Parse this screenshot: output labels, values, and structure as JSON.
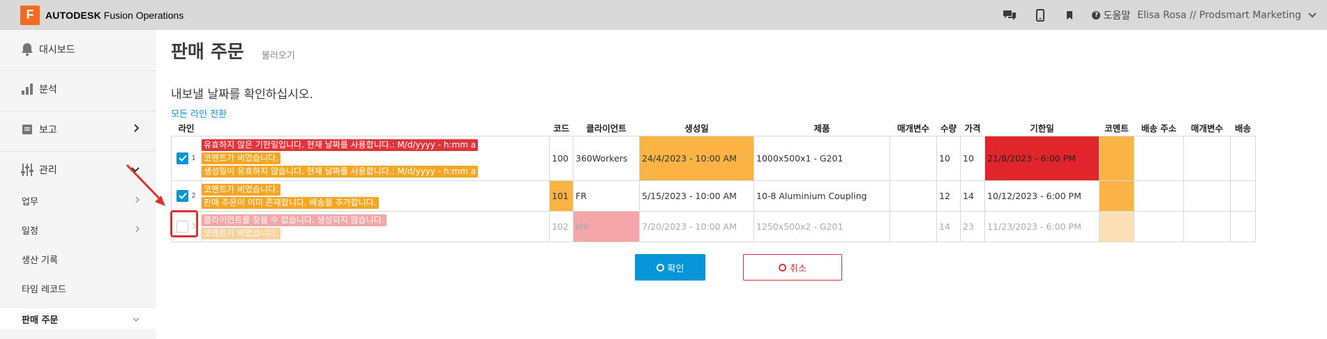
{
  "topbar": {
    "logo_letter": "F",
    "brand_bold": "AUTODESK",
    "brand_rest": " Fusion Operations",
    "help_label": "도움말",
    "user_label": "Elisa Rosa // Prodsmart Marketing"
  },
  "sidebar": {
    "dashboard": "대시보드",
    "analysis": "분석",
    "report": "보고",
    "manage": "관리",
    "sub_items": [
      "업무",
      "일정",
      "생산 기록",
      "타임 레코드",
      "판매 주문"
    ]
  },
  "page": {
    "title": "판매 주문",
    "subtitle": "불러오기",
    "confirm_message": "내보낼 날짜를 확인하십시오.",
    "toggle_all_link": "모든 라인 전환"
  },
  "table": {
    "headers": [
      "라인",
      "코드",
      "클라이언트",
      "생성일",
      "제품",
      "매개변수",
      "수량",
      "가격",
      "기한일",
      "코멘트",
      "배송 주소",
      "매개변수",
      "배송"
    ],
    "rows": [
      {
        "num": "1",
        "checked": true,
        "messages": [
          {
            "text": "유효하지 않은 기한일입니다. 현재 날짜를 사용합니다.: M/d/yyyy - h:mm a",
            "color": "red"
          },
          {
            "text": "코멘트가 비었습니다.",
            "color": "orange"
          },
          {
            "text": "생성일이 유효하지 않습니다. 현재 날짜를 사용합니다.: M/d/yyyy - h:mm a",
            "color": "orange"
          }
        ],
        "code": "100",
        "client": "360Workers",
        "created": "24/4/2023 - 10:00 AM",
        "product": "1000x500x1 - G201",
        "param": "",
        "qty": "10",
        "price": "10",
        "due": "21/8/2023 - 6:00 PM"
      },
      {
        "num": "2",
        "checked": true,
        "messages": [
          {
            "text": "코멘트가 비었습니다.",
            "color": "orange"
          },
          {
            "text": "판매 주문이 이미 존재합니다. 배송을 추가합니다.",
            "color": "orange"
          }
        ],
        "code": "101",
        "client": "FR",
        "created": "5/15/2023 - 10:00 AM",
        "product": "10-8 Aluminium Coupling",
        "param": "",
        "qty": "12",
        "price": "14",
        "due": "10/12/2023 - 6:00 PM"
      },
      {
        "num": "3",
        "checked": false,
        "messages": [
          {
            "text": "클라이언트를 찾을 수 없습니다. 생성되지 않습니다.",
            "color": "red"
          },
          {
            "text": "코멘트가 비었습니다.",
            "color": "orange"
          }
        ],
        "code": "102",
        "client": "MR",
        "created": "7/20/2023 - 10:00 AM",
        "product": "1250x500x2 - G201",
        "param": "",
        "qty": "14",
        "price": "23",
        "due": "11/23/2023 - 6:00 PM"
      }
    ]
  },
  "buttons": {
    "ok": "확인",
    "cancel": "취소"
  },
  "colors": {
    "accent": "#0696d7",
    "warning": "#fbb343",
    "error": "#e0262a",
    "logo": "#f26b21"
  }
}
